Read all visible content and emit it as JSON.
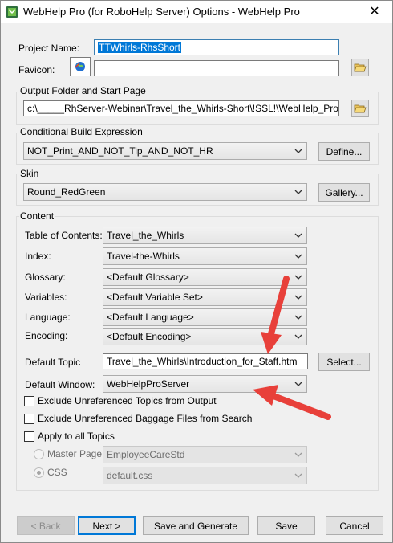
{
  "window": {
    "title": "WebHelp Pro (for RoboHelp Server) Options - WebHelp Pro",
    "close_glyph": "✕"
  },
  "project": {
    "name_label": "Project Name:",
    "name_value": "TTWhirls-RhsShort",
    "favicon_label": "Favicon:",
    "favicon_value": ""
  },
  "output": {
    "group_label": "Output Folder and Start Page",
    "path": "c:\\_____RhServer-Webinar\\Travel_the_Whirls-Short\\!SSL!\\WebHelp_Pro"
  },
  "conditional": {
    "group_label": "Conditional Build Expression",
    "value": "NOT_Print_AND_NOT_Tip_AND_NOT_HR",
    "define_label": "Define..."
  },
  "skin": {
    "group_label": "Skin",
    "value": "Round_RedGreen",
    "gallery_label": "Gallery..."
  },
  "content": {
    "group_label": "Content",
    "toc_label": "Table of Contents:",
    "toc_value": "Travel_the_Whirls",
    "index_label": "Index:",
    "index_value": "Travel-the-Whirls",
    "glossary_label": "Glossary:",
    "glossary_value": "<Default Glossary>",
    "variables_label": "Variables:",
    "variables_value": "<Default Variable Set>",
    "language_label": "Language:",
    "language_value": "<Default Language>",
    "encoding_label": "Encoding:",
    "encoding_value": "<Default Encoding>",
    "default_topic_label": "Default Topic",
    "default_topic_value": "Travel_the_Whirls\\Introduction_for_Staff.htm",
    "select_label": "Select...",
    "default_window_label": "Default Window:",
    "default_window_value": "WebHelpProServer",
    "exclude_topics_label": "Exclude Unreferenced Topics from Output",
    "exclude_baggage_label": "Exclude Unreferenced Baggage Files from Search",
    "apply_all_label": "Apply to all Topics",
    "master_page_label": "Master Page",
    "master_page_value": "EmployeeCareStd",
    "css_label": "CSS",
    "css_value": "default.css"
  },
  "footer": {
    "back_label": "< Back",
    "next_label": "Next >",
    "save_generate_label": "Save and Generate",
    "save_label": "Save",
    "cancel_label": "Cancel"
  },
  "colors": {
    "annotation_arrow": "#e8403a",
    "selection": "#0078d7"
  }
}
